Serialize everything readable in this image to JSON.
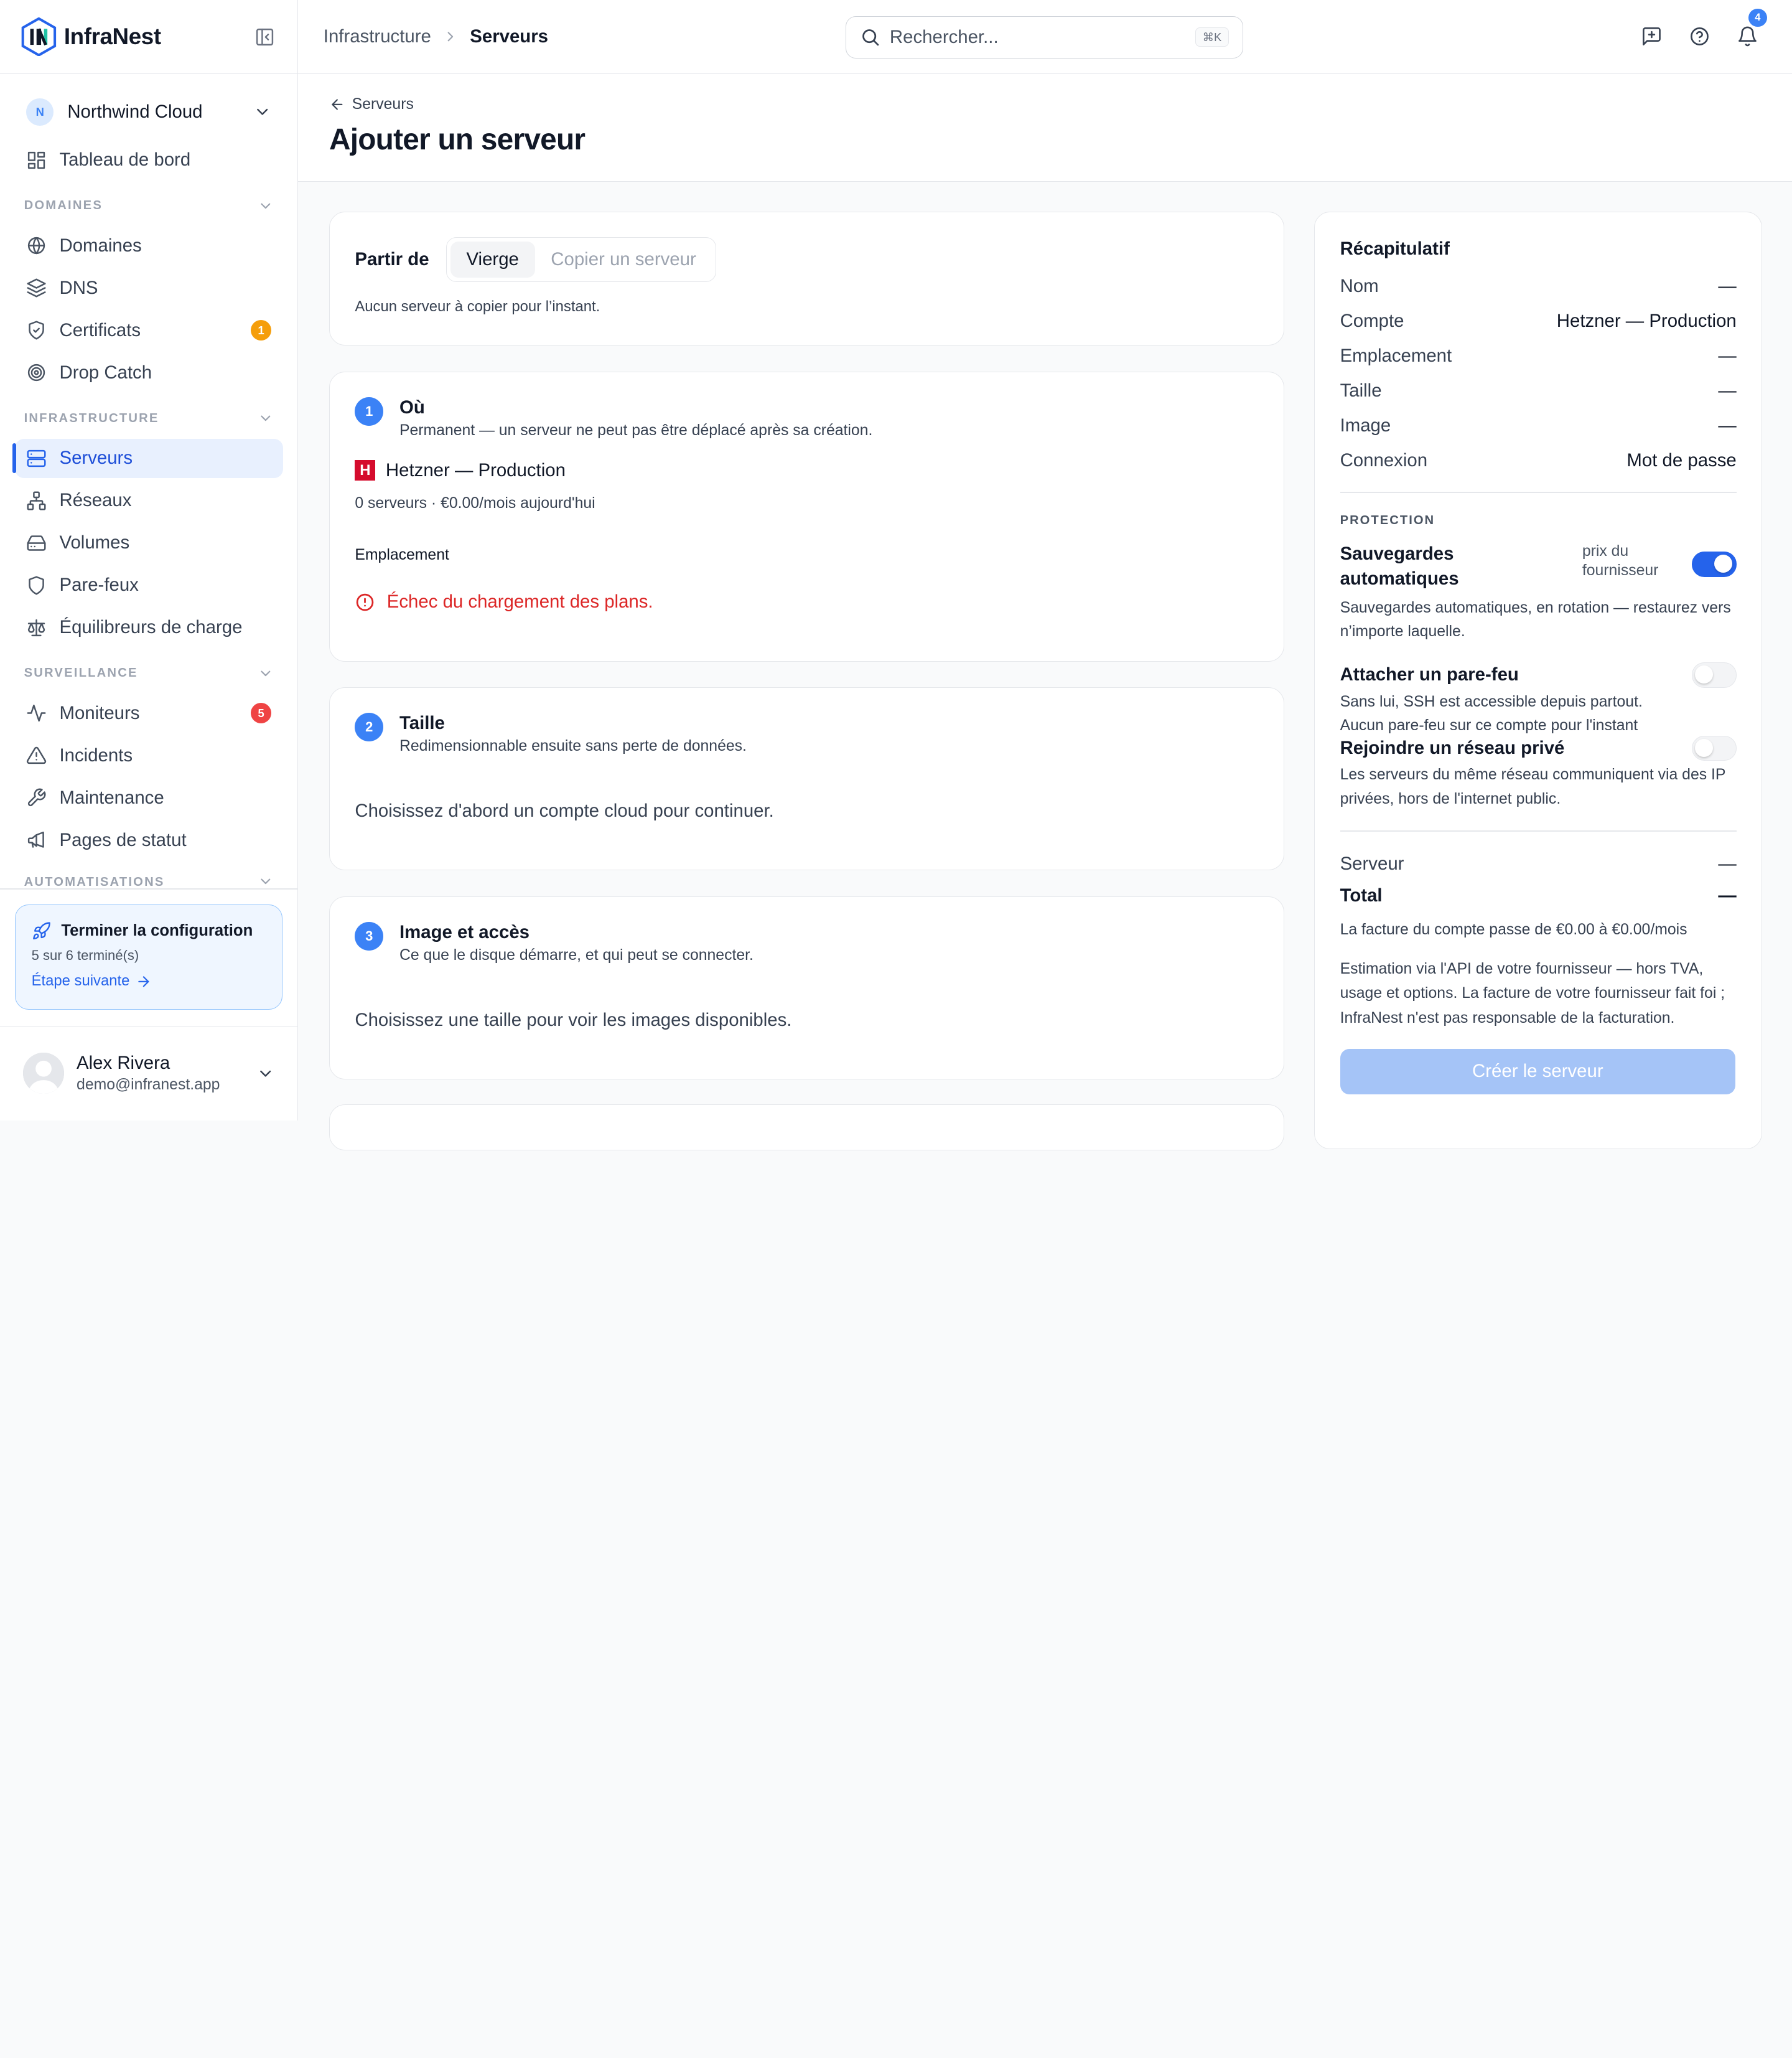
{
  "app": {
    "name": "InfraNest"
  },
  "sidebar": {
    "org": {
      "initial": "N",
      "name": "Northwind Cloud"
    },
    "dashboard": "Tableau de bord",
    "sections": [
      {
        "label": "DOMAINES",
        "items": [
          {
            "label": "Domaines",
            "icon": "globe-icon"
          },
          {
            "label": "DNS",
            "icon": "layers-icon"
          },
          {
            "label": "Certificats",
            "icon": "shield-check-icon",
            "badge": "1",
            "badge_color": "#f59e0b"
          },
          {
            "label": "Drop Catch",
            "icon": "target-icon"
          }
        ]
      },
      {
        "label": "INFRASTRUCTURE",
        "items": [
          {
            "label": "Serveurs",
            "icon": "server-icon",
            "active": true
          },
          {
            "label": "Réseaux",
            "icon": "network-icon"
          },
          {
            "label": "Volumes",
            "icon": "hard-drive-icon"
          },
          {
            "label": "Pare-feux",
            "icon": "shield-icon"
          },
          {
            "label": "Équilibreurs de charge",
            "icon": "scale-icon"
          }
        ]
      },
      {
        "label": "SURVEILLANCE",
        "items": [
          {
            "label": "Moniteurs",
            "icon": "activity-icon",
            "badge": "5",
            "badge_color": "#ef4444"
          },
          {
            "label": "Incidents",
            "icon": "alert-triangle-icon"
          },
          {
            "label": "Maintenance",
            "icon": "wrench-icon"
          },
          {
            "label": "Pages de statut",
            "icon": "megaphone-icon"
          }
        ]
      },
      {
        "label": "AUTOMATISATIONS"
      }
    ],
    "setup": {
      "title": "Terminer la configuration",
      "progress": "5 sur 6 terminé(s)",
      "next": "Étape suivante"
    },
    "user": {
      "name": "Alex Rivera",
      "email": "demo@infranest.app"
    }
  },
  "topbar": {
    "breadcrumb": [
      "Infrastructure",
      "Serveurs"
    ],
    "search_placeholder": "Rechercher...",
    "search_shortcut": "⌘K",
    "notifications_count": "4"
  },
  "page": {
    "back": "Serveurs",
    "title": "Ajouter un serveur"
  },
  "start": {
    "label": "Partir de",
    "options": [
      "Vierge",
      "Copier un serveur"
    ],
    "selected": "Vierge",
    "hint": "Aucun serveur à copier pour l’instant."
  },
  "steps": {
    "where": {
      "number": "1",
      "title": "Où",
      "subtitle": "Permanent — un serveur ne peut pas être déplacé après sa création.",
      "provider_logo": "H",
      "provider": "Hetzner — Production",
      "provider_meta": "0 serveurs · €0.00/mois aujourd'hui",
      "location_label": "Emplacement",
      "error": "Échec du chargement des plans."
    },
    "size": {
      "number": "2",
      "title": "Taille",
      "subtitle": "Redimensionnable ensuite sans perte de données.",
      "message": "Choisissez d'abord un compte cloud pour continuer."
    },
    "image": {
      "number": "3",
      "title": "Image et accès",
      "subtitle": "Ce que le disque démarre, et qui peut se connecter.",
      "message": "Choisissez une taille pour voir les images disponibles."
    }
  },
  "summary": {
    "title": "Récapitulatif",
    "rows": [
      {
        "label": "Nom",
        "value": "—"
      },
      {
        "label": "Compte",
        "value": "Hetzner — Production"
      },
      {
        "label": "Emplacement",
        "value": "—"
      },
      {
        "label": "Taille",
        "value": "—"
      },
      {
        "label": "Image",
        "value": "—"
      },
      {
        "label": "Connexion",
        "value": "Mot de passe"
      }
    ],
    "protection_label": "PROTECTION",
    "backups": {
      "title": "Sauvegardes automatiques",
      "note": "prix du fournisseur",
      "desc": "Sauvegardes automatiques, en rotation — restaurez vers n’importe laquelle.",
      "enabled": true
    },
    "firewall": {
      "title": "Attacher un pare-feu",
      "desc": "Sans lui, SSH est accessible depuis partout.",
      "desc2": "Aucun pare-feu sur ce compte pour l'instant",
      "enabled": false
    },
    "private_network": {
      "title": "Rejoindre un réseau privé",
      "desc": "Les serveurs du même réseau communiquent via des IP privées, hors de l'internet public.",
      "enabled": false
    },
    "server_label": "Serveur",
    "server_value": "—",
    "total_label": "Total",
    "total_value": "—",
    "bill": "La facture du compte passe de €0.00 à €0.00/mois",
    "estimate": "Estimation via l'API de votre fournisseur — hors TVA, usage et options. La facture de votre fournisseur fait foi ; InfraNest n'est pas responsable de la facturation.",
    "create_button": "Créer le serveur"
  },
  "colors": {
    "accent": "#2563eb",
    "error": "#dc2626",
    "hetzner": "#d50c2d"
  }
}
